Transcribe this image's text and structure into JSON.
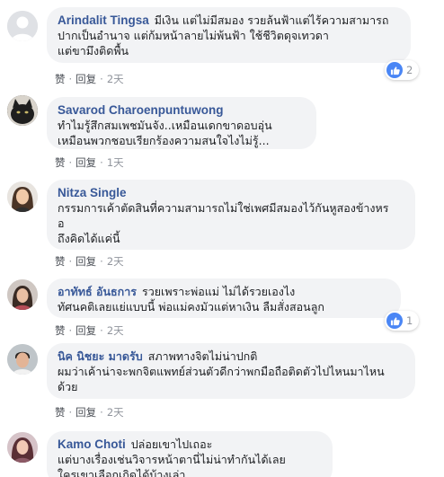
{
  "comments": [
    {
      "author": "Arindalit Tingsa",
      "text_lines": [
        "มีเงิน แต่ไม่มีสมอง รวยล้นฟ้าแต่ไร้ความสามารถ",
        "ปากเป็นอำนาจ แต่ก้มหน้าลายไม่พ้นฟ้า ใช้ชีวิตดุจเทวดา",
        "แต่ขามึงติดพื้น"
      ],
      "like_label": "赞",
      "reply_label": "回复",
      "time": "2天",
      "reaction_count": "2"
    },
    {
      "author": "Savarod Charoenpuntuwong",
      "text_lines": [
        "ทำไมรู้สึกสมเพชมันจัง..เหมือนเดกขาดอบอุ่น",
        "เหมือนพวกชอบเรียกร้องความสนใจไงไม่รู้..."
      ],
      "like_label": "赞",
      "reply_label": "回复",
      "time": "1天"
    },
    {
      "author": "Nitza Single",
      "text_lines": [
        "กรรมการเค้าตัดสินที่ความสามารถไม่ใช่เพศมีสมองไว้กันหูสองข้างหร",
        "อ",
        "ถึงคิดได้แค่นี้"
      ],
      "like_label": "赞",
      "reply_label": "回复",
      "time": "2天"
    },
    {
      "author": "อาทัทธ์ อันธการ",
      "inline_text": "รวยเพราะพ่อแม่ ไม่ได้รวยเองไง",
      "text_lines": [
        "ทัศนคติเลยแย่แบบนี้ พ่อแม่คงมัวแต่หาเงิน ลืมสั่งสอนลูก"
      ],
      "like_label": "赞",
      "reply_label": "回复",
      "time": "2天",
      "reaction_count": "1"
    },
    {
      "author": "นิค นิชยะ มาดรับ",
      "inline_text": "สภาพทางจิตไม่น่าปกติ",
      "text_lines": [
        "ผมว่าเค้าน่าจะพกจิตแพทย์ส่วนตัวดีกว่าพกมือถือติดตัวไปไหนมาไหน",
        "ด้วย"
      ],
      "like_label": "赞",
      "reply_label": "回复",
      "time": "2天"
    },
    {
      "author": "Kamo Choti",
      "inline_text": "ปล่อยเขาไปเถอะ",
      "text_lines": [
        "แต่บางเรื่องเช่นวิจารหน้าตานี่ไม่น่าทำกันได้เลย",
        "ใครเขาเลือกเกิดได้บ้างเล่า"
      ]
    }
  ],
  "colors": {
    "author": "#385898",
    "bubble": "#f2f3f5",
    "like_blue": "#4a86f5"
  }
}
